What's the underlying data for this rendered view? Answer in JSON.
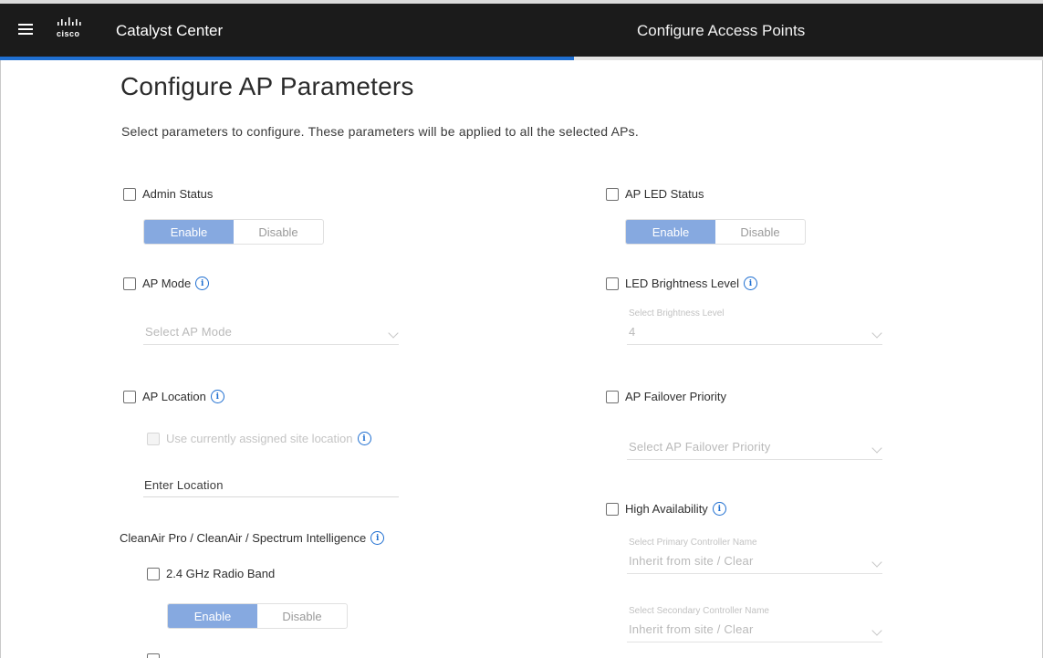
{
  "header": {
    "brand": "cisco",
    "app_title": "Catalyst Center",
    "page_heading": "Configure Access Points",
    "progress_percent": 55
  },
  "page": {
    "title": "Configure AP Parameters",
    "intro": "Select parameters to configure. These parameters will be applied to all the selected APs."
  },
  "left": {
    "admin_status": {
      "label": "Admin Status",
      "enable": "Enable",
      "disable": "Disable"
    },
    "ap_mode": {
      "label": "AP Mode",
      "placeholder": "Select AP Mode"
    },
    "ap_location": {
      "label": "AP Location",
      "use_site_label": "Use currently assigned site location",
      "location_value": "Enter Location"
    },
    "cleanair": {
      "label": "CleanAir Pro / CleanAir / Spectrum Intelligence",
      "band_24": {
        "label": "2.4 GHz Radio Band",
        "enable": "Enable",
        "disable": "Disable"
      }
    }
  },
  "right": {
    "led_status": {
      "label": "AP LED Status",
      "enable": "Enable",
      "disable": "Disable"
    },
    "led_brightness": {
      "label": "LED Brightness Level",
      "field_label": "Select Brightness Level",
      "value": "4"
    },
    "failover": {
      "label": "AP Failover Priority",
      "placeholder": "Select AP Failover Priority"
    },
    "high_availability": {
      "label": "High Availability",
      "primary_label": "Select Primary Controller Name",
      "primary_value": "Inherit from site / Clear",
      "secondary_label": "Select Secondary Controller Name",
      "secondary_value": "Inherit from site / Clear"
    }
  },
  "colors": {
    "topbar": "#1b1b1b",
    "accent": "#1f6fd1",
    "toggle_active": "#86a9e0"
  },
  "icons": {
    "menu": "hamburger-icon",
    "info": "info-icon",
    "chevron": "chevron-down-icon",
    "brand": "cisco-logo"
  }
}
